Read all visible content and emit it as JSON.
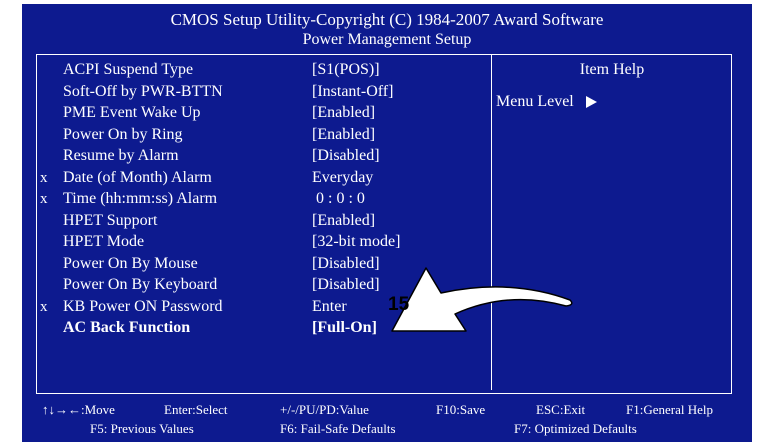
{
  "header": {
    "title": "CMOS Setup Utility-Copyright (C) 1984-2007 Award Software",
    "subtitle": "Power Management Setup"
  },
  "settings": [
    {
      "marker": "",
      "label": "ACPI Suspend Type",
      "value": "[S1(POS)]"
    },
    {
      "marker": "",
      "label": "Soft-Off by PWR-BTTN",
      "value": "[Instant-Off]"
    },
    {
      "marker": "",
      "label": "PME Event Wake Up",
      "value": "[Enabled]"
    },
    {
      "marker": "",
      "label": "Power On by Ring",
      "value": "[Enabled]"
    },
    {
      "marker": "",
      "label": "Resume by Alarm",
      "value": "[Disabled]"
    },
    {
      "marker": "x",
      "label": "Date (of Month) Alarm",
      "value": "Everyday"
    },
    {
      "marker": "x",
      "label": "Time (hh:mm:ss) Alarm",
      "value": " 0 : 0 : 0"
    },
    {
      "marker": "",
      "label": "HPET Support",
      "value": "[Enabled]"
    },
    {
      "marker": "",
      "label": "HPET Mode",
      "value": "[32-bit mode]"
    },
    {
      "marker": "",
      "label": "Power On By Mouse",
      "value": "[Disabled]"
    },
    {
      "marker": "",
      "label": "Power On By Keyboard",
      "value": "[Disabled]"
    },
    {
      "marker": "x",
      "label": "KB Power ON Password",
      "value": "Enter"
    },
    {
      "marker": "",
      "label": "AC Back Function",
      "value": "[Full-On]"
    }
  ],
  "help_panel": {
    "title": "Item Help",
    "menu_level": "Menu Level"
  },
  "footer": {
    "move": "↑↓→←:Move",
    "select": "Enter:Select",
    "value": "+/-/PU/PD:Value",
    "save": "F10:Save",
    "exit": "ESC:Exit",
    "help": "F1:General Help",
    "previous": "F5: Previous Values",
    "failsafe": "F6: Fail-Safe Defaults",
    "optimized": "F7: Optimized Defaults"
  },
  "callout": {
    "number": "15"
  },
  "colors": {
    "background": "#0d1a8f",
    "text": "#ffffff"
  }
}
